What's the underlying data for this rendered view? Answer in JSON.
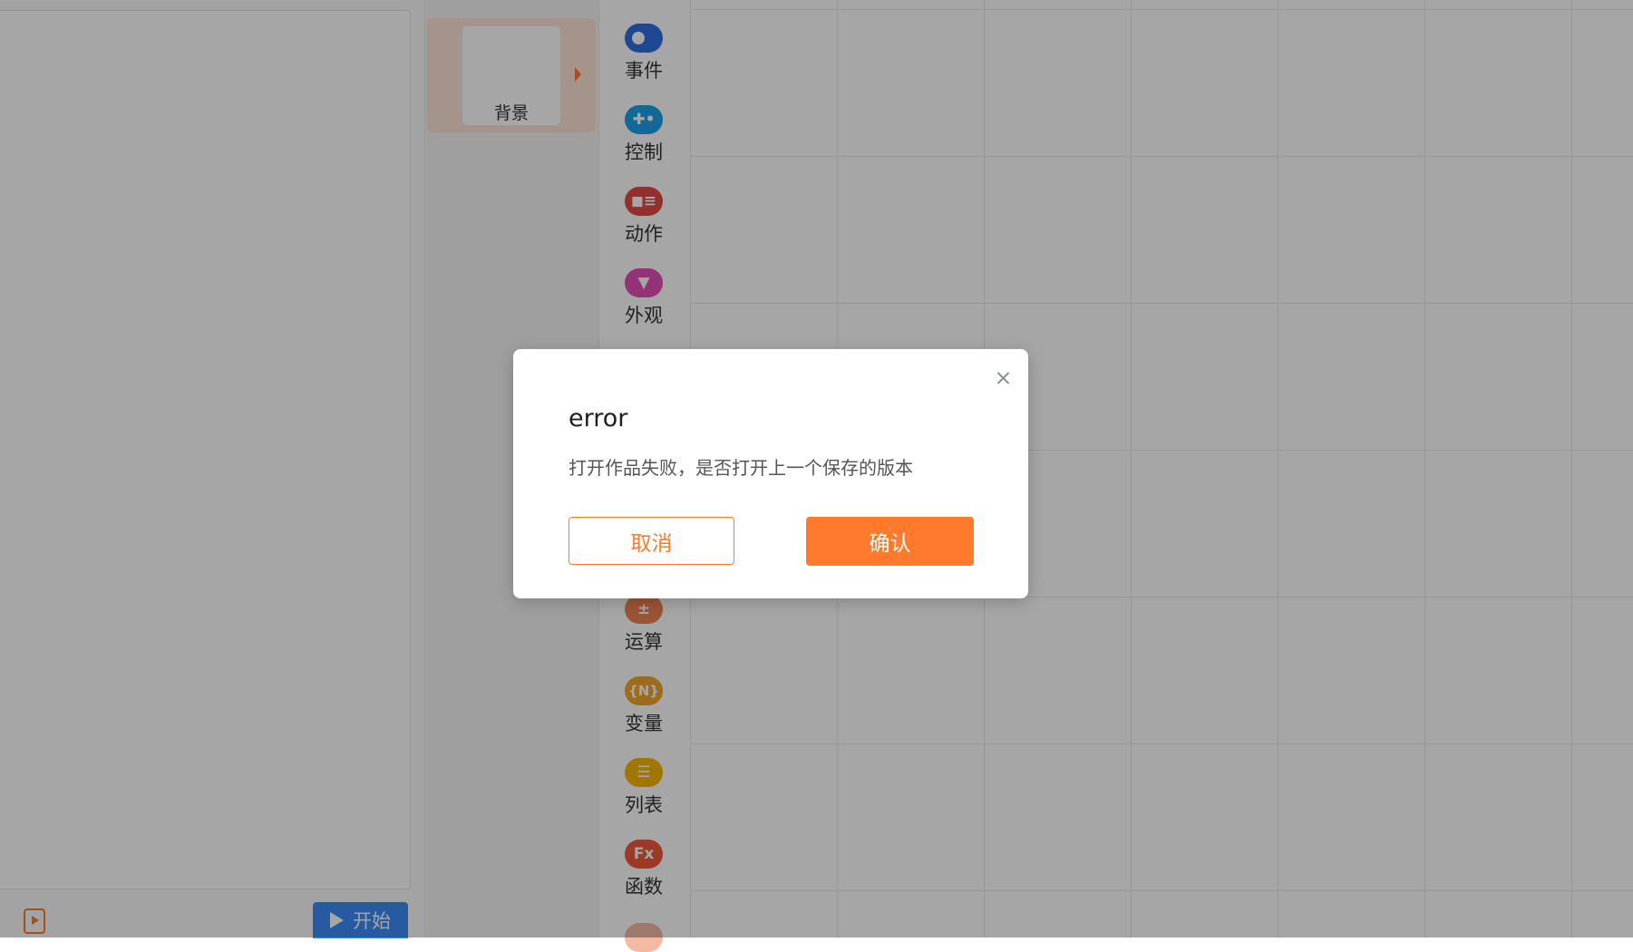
{
  "sprite": {
    "label": "背景"
  },
  "stage": {
    "start_label": "开始"
  },
  "categories": [
    {
      "label": "事件",
      "icon": "toggle-icon",
      "color": "#2f6fe0",
      "glyph": "●"
    },
    {
      "label": "控制",
      "icon": "gamepad-icon",
      "color": "#1da1e8",
      "glyph": "✚"
    },
    {
      "label": "动作",
      "icon": "ghost-icon",
      "color": "#e14a45",
      "glyph": "◼"
    },
    {
      "label": "外观",
      "icon": "shirt-icon",
      "color": "#e24fb4",
      "glyph": "▀"
    },
    {
      "label": "运算",
      "icon": "math-icon",
      "color": "#ef8255",
      "glyph": "±"
    },
    {
      "label": "变量",
      "icon": "variable-icon",
      "color": "#f1a72a",
      "glyph": "{N}"
    },
    {
      "label": "列表",
      "icon": "list-icon",
      "color": "#f6b700",
      "glyph": "☰"
    },
    {
      "label": "函数",
      "icon": "function-icon",
      "color": "#f0593c",
      "glyph": "Fx"
    }
  ],
  "dialog": {
    "title": "error",
    "message": "打开作品失败，是否打开上一个保存的版本",
    "cancel_label": "取消",
    "confirm_label": "确认"
  },
  "colors": {
    "accent": "#ff7a2c",
    "start_button": "#3c8df7"
  }
}
